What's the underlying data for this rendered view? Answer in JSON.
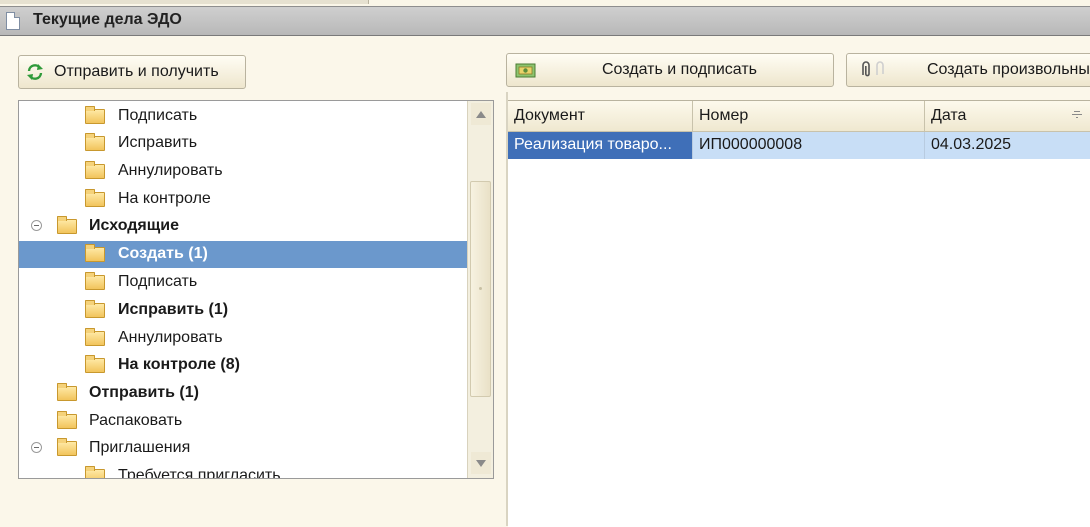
{
  "window": {
    "title": "Текущие дела ЭДО"
  },
  "toolbar": {
    "send_receive": "Отправить и получить",
    "create_sign": "Создать и подписать",
    "create_custom": "Создать произвольный"
  },
  "tree": {
    "items": [
      {
        "label": "Подписать",
        "level": 1,
        "bold": false,
        "expanded": null,
        "selected": false
      },
      {
        "label": "Исправить",
        "level": 1,
        "bold": false,
        "expanded": null,
        "selected": false
      },
      {
        "label": "Аннулировать",
        "level": 1,
        "bold": false,
        "expanded": null,
        "selected": false
      },
      {
        "label": "На контроле",
        "level": 1,
        "bold": false,
        "expanded": null,
        "selected": false
      },
      {
        "label": "Исходящие",
        "level": 0,
        "bold": true,
        "expanded": true,
        "selected": false
      },
      {
        "label": "Создать (1)",
        "level": 1,
        "bold": true,
        "expanded": null,
        "selected": true
      },
      {
        "label": "Подписать",
        "level": 1,
        "bold": false,
        "expanded": null,
        "selected": false
      },
      {
        "label": "Исправить (1)",
        "level": 1,
        "bold": true,
        "expanded": null,
        "selected": false
      },
      {
        "label": "Аннулировать",
        "level": 1,
        "bold": false,
        "expanded": null,
        "selected": false
      },
      {
        "label": "На контроле (8)",
        "level": 1,
        "bold": true,
        "expanded": null,
        "selected": false
      },
      {
        "label": "Отправить (1)",
        "level": 0,
        "bold": true,
        "expanded": null,
        "selected": false
      },
      {
        "label": "Распаковать",
        "level": 0,
        "bold": false,
        "expanded": null,
        "selected": false
      },
      {
        "label": "Приглашения",
        "level": 0,
        "bold": false,
        "expanded": true,
        "selected": false
      },
      {
        "label": "Требуется пригласить",
        "level": 1,
        "bold": false,
        "expanded": null,
        "selected": false
      }
    ]
  },
  "table": {
    "columns": [
      "Документ",
      "Номер",
      "Дата"
    ],
    "rows": [
      [
        "Реализация товаро...",
        "ИП000000008",
        "04.03.2025"
      ]
    ]
  },
  "colors": {
    "selection": "#6b98cc",
    "row_highlight": "#c8def6",
    "current_cell": "#3f6fb8",
    "background": "#fbf7ea"
  }
}
